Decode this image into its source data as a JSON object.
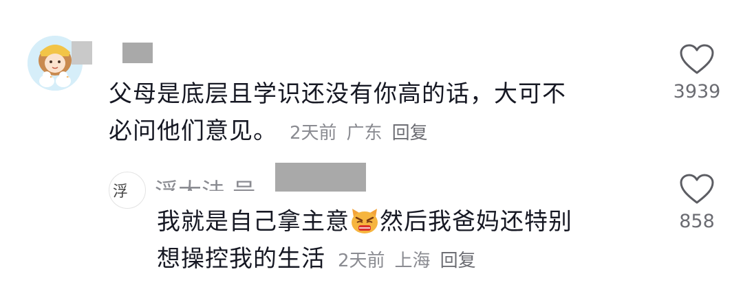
{
  "comments": [
    {
      "text_line1": "父母是底层且学识还没有你高的话，大可不",
      "text_line2": "必问他们意见。",
      "time": "2天前",
      "location": "广东",
      "reply_label": "回复",
      "like_icon": "heart-outline-icon",
      "like_count": "3939"
    }
  ],
  "replies": [
    {
      "name_partial": "浮大法 号",
      "text_line1_a": "我就是自己拿主意",
      "emoji": "angry-cat-emoji",
      "text_line1_b": "然后我爸妈还特别",
      "text_line2": "想操控我的生活",
      "time": "2天前",
      "location": "上海",
      "reply_label": "回复",
      "like_icon": "heart-outline-icon",
      "like_count": "858"
    }
  ],
  "colors": {
    "text": "#161823",
    "meta": "#8a8b91",
    "heart_stroke": "#5c5d63",
    "redaction": "#a9a9a9"
  }
}
